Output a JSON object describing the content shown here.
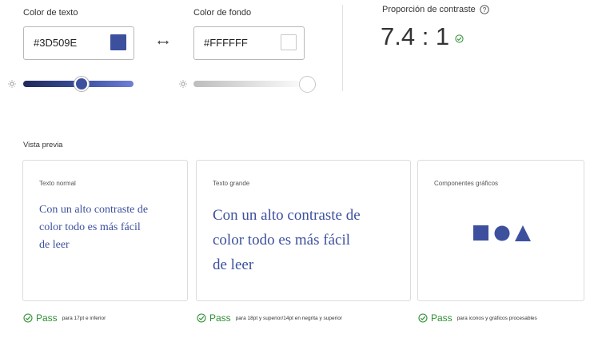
{
  "text_color": {
    "label": "Color de texto",
    "value": "#3D509E",
    "swatch": "#3D509E",
    "brightness": 0.55
  },
  "background_color": {
    "label": "Color de fondo",
    "value": "#FFFFFF",
    "swatch": "#FFFFFF",
    "brightness": 1.0
  },
  "swap_icon": "swap-arrows-icon",
  "contrast": {
    "label": "Proporción de contraste",
    "info_icon": "question-circle-icon",
    "ratio": "7.4 : 1",
    "status_icon": "check-circle-icon"
  },
  "preview": {
    "label": "Vista previa",
    "cards": [
      {
        "title": "Texto normal",
        "sample_lines": [
          "Con un alto contraste de",
          "color todo es más fácil",
          "de leer"
        ]
      },
      {
        "title": "Texto grande",
        "sample_lines": [
          "Con un alto contraste de",
          "color todo es más fácil",
          "de leer"
        ]
      },
      {
        "title": "Componentes gráficos",
        "shapes": [
          "square",
          "circle",
          "triangle"
        ]
      }
    ],
    "results": [
      {
        "status": "Pass",
        "description": "para 17pt e inferior"
      },
      {
        "status": "Pass",
        "description": "para 18pt y superior/14pt en negrita y superior"
      },
      {
        "status": "Pass",
        "description": "para iconos y gráficos procesables"
      }
    ]
  },
  "colors": {
    "accent": "#3D509E",
    "pass_green": "#2d8f32",
    "divider": "#e0e0e0"
  }
}
